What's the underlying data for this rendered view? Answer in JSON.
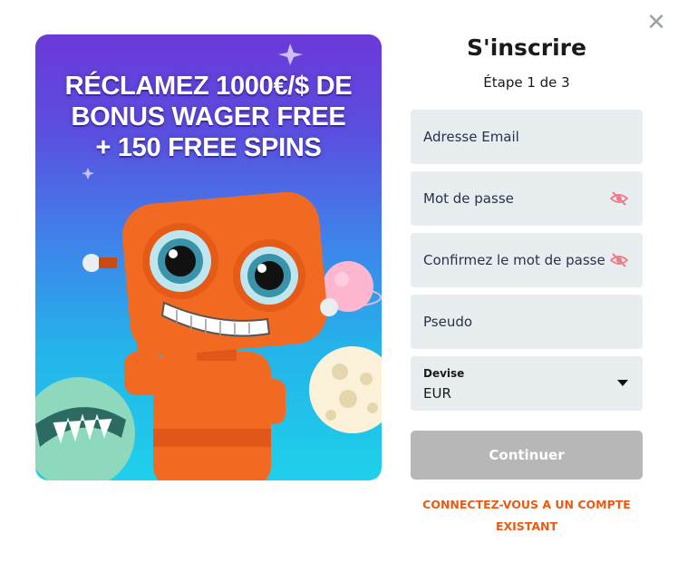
{
  "dialog": {
    "close_icon": "close-icon"
  },
  "promo": {
    "headline_line1": "RÉCLAMEZ 1000€/$ DE",
    "headline_line2": "BONUS WAGER FREE",
    "headline_line3": "+ 150 FREE SPINS",
    "background_top": "#6b39d8",
    "background_bottom": "#1ed0ea",
    "mascot_color": "#f26a21"
  },
  "form": {
    "title": "S'inscrire",
    "step": "Étape 1 de 3",
    "email_label": "Adresse Email",
    "password_label": "Mot de passe",
    "confirm_label": "Confirmez le mot de passe",
    "username_label": "Pseudo",
    "currency_label": "Devise",
    "currency_value": "EUR",
    "password_toggle_icon": "eye-slash-icon",
    "continue_label": "Continuer",
    "login_link_line1": "CONNECTEZ-VOUS A UN COMPTE",
    "login_link_line2": "EXISTANT",
    "field_bg": "#e8edf0",
    "button_bg": "#b7b7b7",
    "link_color": "#ea5a13",
    "eye_color": "#f07a8a"
  }
}
